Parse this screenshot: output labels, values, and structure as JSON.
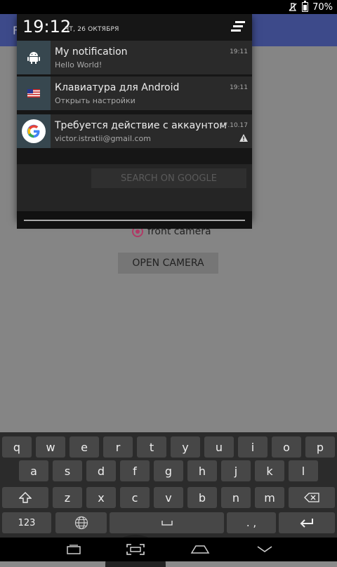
{
  "status_bar": {
    "battery": "70%"
  },
  "app": {
    "title_fragment": "F",
    "radio_label": "front camera",
    "open_camera_label": "OPEN CAMERA"
  },
  "shade": {
    "clock": "19:12",
    "date": "ЧТ, 26 ОКТЯБРЯ",
    "notifications": [
      {
        "title": "My notification",
        "subtitle": "Hello World!",
        "time": "19:11",
        "icon": "android-icon"
      },
      {
        "title": "Клавиатура для Android",
        "subtitle": "Открыть настройки",
        "time": "19:11",
        "icon": "us-flag-icon"
      },
      {
        "title": "Требуется действие с аккаунтом",
        "subtitle": "victor.istratii@gmail.com",
        "time": "17.10.17",
        "icon": "google-icon"
      }
    ],
    "search_google_label": "SEARCH ON GOOGLE"
  },
  "keyboard": {
    "row1": [
      "q",
      "w",
      "e",
      "r",
      "t",
      "y",
      "u",
      "i",
      "o",
      "p"
    ],
    "row2": [
      "a",
      "s",
      "d",
      "f",
      "g",
      "h",
      "j",
      "k",
      "l"
    ],
    "row3": [
      "z",
      "x",
      "c",
      "v",
      "b",
      "n",
      "m"
    ],
    "symbols_key": "123",
    "punctuation_key": ". ,"
  },
  "colors": {
    "app_bar": "#3d4a8a",
    "radio_accent": "#b03a66"
  }
}
